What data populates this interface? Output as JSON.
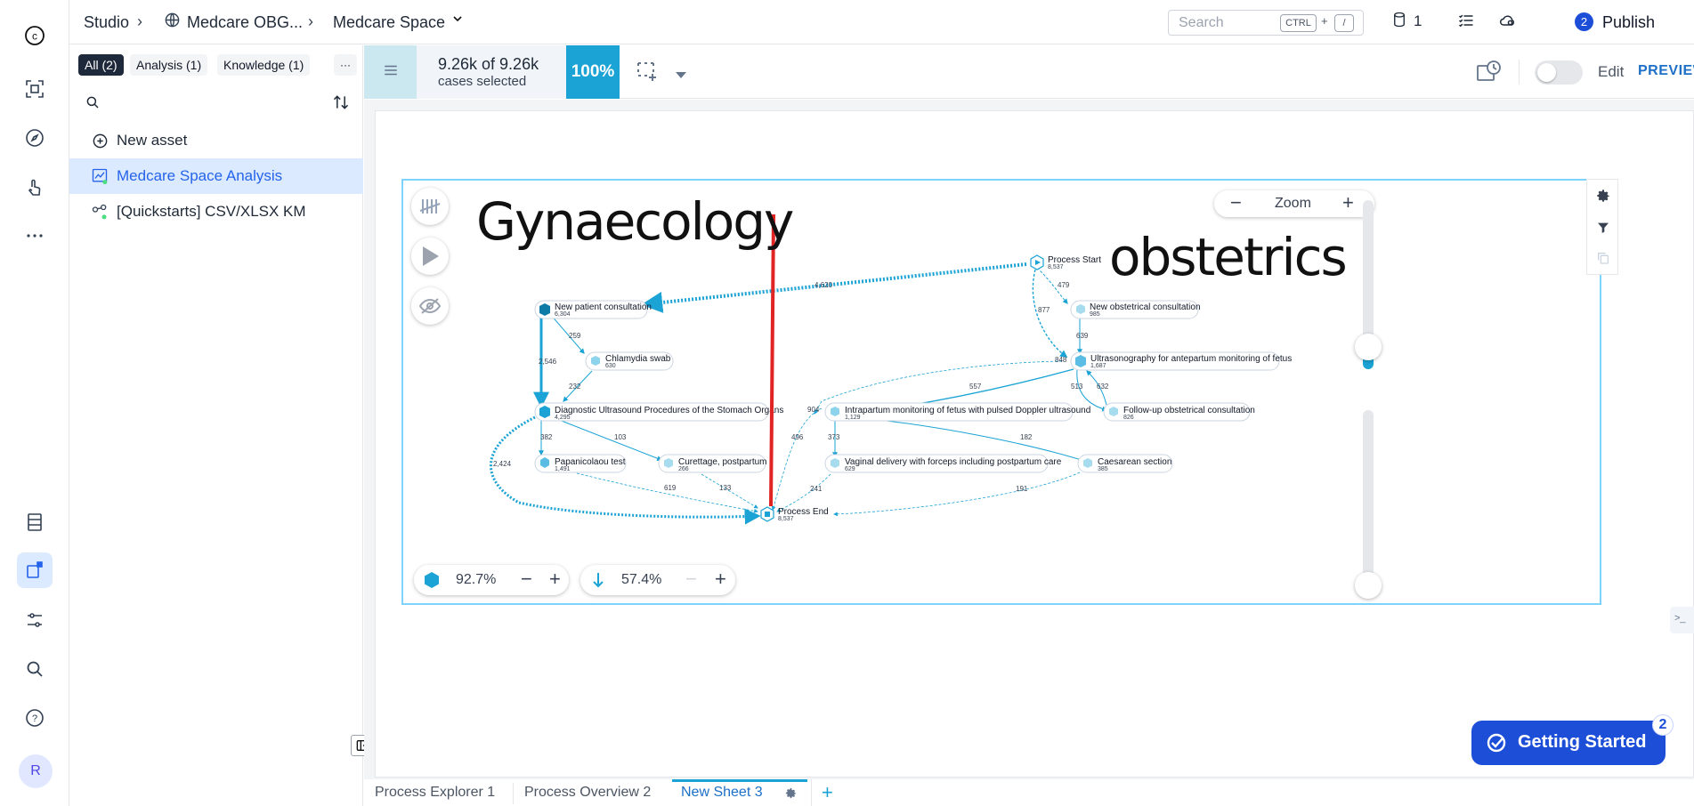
{
  "topbar": {
    "breadcrumbs": [
      "Studio",
      "Medcare OBG...",
      "Medcare Space"
    ],
    "search_placeholder": "Search",
    "kbd_ctrl": "CTRL",
    "kbd_plus": "+",
    "kbd_slash": "/",
    "db_count": "1",
    "publish_count": "2",
    "publish_label": "Publish"
  },
  "sidebar": {
    "chips": [
      "All (2)",
      "Analysis (1)",
      "Knowledge (1)",
      "···"
    ],
    "new_asset": "New asset",
    "assets": [
      "Medcare Space Analysis",
      "[Quickstarts] CSV/XLSX KM"
    ]
  },
  "filterbar": {
    "cases_big": "9.26k of 9.26k",
    "cases_small": "cases selected",
    "percent": "100%",
    "edit_label": "Edit",
    "preview_label": "PREVIEW"
  },
  "map": {
    "zoom_label": "Zoom",
    "activity_slider": "92.7%",
    "path_slider": "57.4%",
    "annotations": [
      "Gynaecology",
      "obstetrics"
    ],
    "nodes": {
      "start": {
        "label": "Process Start",
        "count": "8,537"
      },
      "end": {
        "label": "Process End",
        "count": "8,537"
      },
      "new_patient": {
        "label": "New patient consultation",
        "count": "6,304"
      },
      "chlamydia": {
        "label": "Chlamydia swab",
        "count": "630"
      },
      "diag_us": {
        "label": "Diagnostic Ultrasound Procedures of the Stomach Organs",
        "count": "4,295"
      },
      "pap": {
        "label": "Papanicolaou test",
        "count": "1,491"
      },
      "curettage": {
        "label": "Curettage, postpartum",
        "count": "266"
      },
      "new_obs": {
        "label": "New obstetrical consultation",
        "count": "985"
      },
      "us_ante": {
        "label": "Ultrasonography for antepartum monitoring of fetus",
        "count": "1,687"
      },
      "intrapartum": {
        "label": "Intrapartum monitoring of fetus with pulsed Doppler ultrasound",
        "count": "1,129"
      },
      "followup": {
        "label": "Follow-up obstetrical consultation",
        "count": "826"
      },
      "vaginal": {
        "label": "Vaginal delivery with forceps including postpartum care",
        "count": "629"
      },
      "caesarean": {
        "label": "Caesarean section",
        "count": "385"
      }
    },
    "edges": {
      "e_start_np": "4,620",
      "e_start_nobs": "479",
      "e_start_us": "877",
      "e_np_chl": "259",
      "e_np_diag": "2,546",
      "e_chl_diag": "232",
      "e_diag_pap": "382",
      "e_diag_cur": "103",
      "e_diag_end": "2,424",
      "e_pap_end": "619",
      "e_cur_end": "133",
      "e_nobs_us": "639",
      "e_us_in": "848",
      "e_us_intra": "557",
      "e_us_fu": "513",
      "e_fu_us": "632",
      "e_intra_vag": "373",
      "e_intra_cae": "182",
      "e_intra_end": "496",
      "e_end_intra": "904",
      "e_vag_end": "241",
      "e_cae_end": "191"
    }
  },
  "tabs": [
    "Process Explorer 1",
    "Process Overview 2",
    "New Sheet 3"
  ],
  "getting_started": {
    "label": "Getting Started",
    "badge": "2"
  },
  "user_initial": "R",
  "colors": {
    "accent": "#1aa3d4",
    "brand": "#1d4ed8",
    "annotation_line": "#e02424"
  }
}
